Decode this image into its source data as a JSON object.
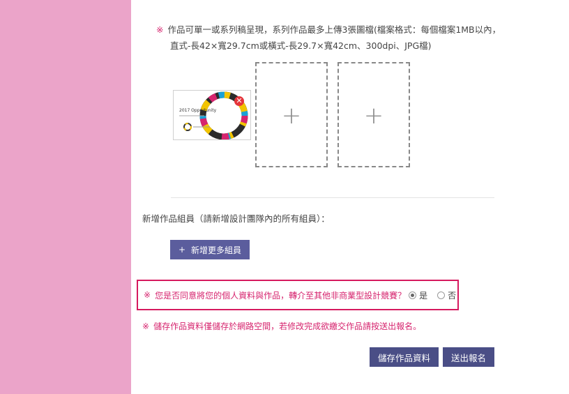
{
  "note": {
    "mark": "※",
    "line1": "作品可單一或系列稿呈現，系列作品最多上傳3張圖檔(檔案格式：每個檔案1MB以內，",
    "line2": "直式-長42×寬29.7cm或橫式-長29.7×寬42cm、300dpi、JPG檔)"
  },
  "thumbnail": {
    "title": "2017 Opportunity",
    "remove_icon": "close-icon"
  },
  "upload_slots": [
    {
      "icon": "plus-icon",
      "glyph": "+"
    },
    {
      "icon": "plus-icon",
      "glyph": "+"
    }
  ],
  "members": {
    "label": "新增作品組員（請新增設計團隊內的所有組員）：",
    "add_button_icon": "+",
    "add_button": "新增更多組員"
  },
  "consent": {
    "mark": "※",
    "question": "您是否同意將您的個人資料與作品，轉介至其他非商業型設計競賽？",
    "options": [
      "是",
      "否"
    ],
    "selected": "是"
  },
  "warning": {
    "mark": "※",
    "text": "儲存作品資料僅儲存於網路空間，若修改完成欲繳交作品請按送出報名。"
  },
  "buttons": {
    "save": "儲存作品資料",
    "submit": "送出報名"
  },
  "colors": {
    "sidebar": "#eba4c9",
    "accent": "#d6246e",
    "button_primary": "#4a4e86",
    "button_secondary": "#5b5d9d"
  }
}
